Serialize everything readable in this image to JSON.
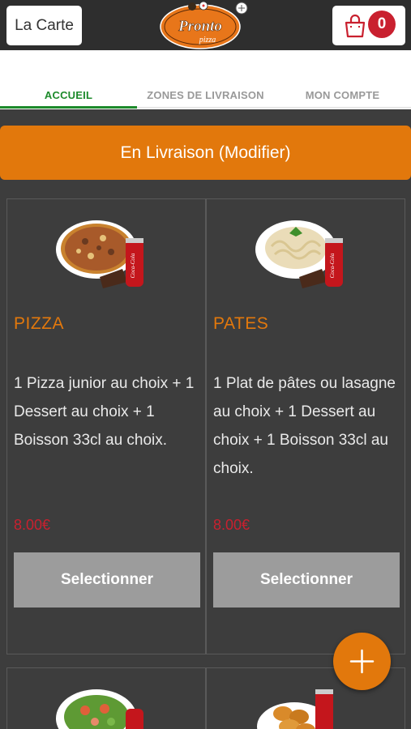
{
  "header": {
    "menu_button": "La Carte",
    "logo_text": "Pronto",
    "logo_subtext": "pizza",
    "cart_count": "0"
  },
  "tabs": [
    {
      "label": "ACCUEIL",
      "active": true
    },
    {
      "label": "ZONES DE LIVRAISON",
      "active": false
    },
    {
      "label": "MON COMPTE",
      "active": false
    }
  ],
  "delivery_button": "En Livraison (Modifier)",
  "products": [
    {
      "title": "PIZZA",
      "description": "1 Pizza junior au choix  + 1 Dessert au choix  + 1 Boisson 33cl au choix.",
      "price": "8.00€",
      "select_label": "Selectionner",
      "image": "pizza-coke-dessert"
    },
    {
      "title": "PATES",
      "description": "1 Plat de pâtes ou lasagne au choix  + 1 Dessert au choix  + 1 Boisson 33cl au choix.",
      "price": "8.00€",
      "select_label": "Selectionner",
      "image": "pasta-coke-dessert"
    },
    {
      "image": "salad-coke"
    },
    {
      "image": "nuggets-coke"
    }
  ],
  "colors": {
    "accent": "#e2780c",
    "active_tab": "#1d8a2b",
    "price": "#c9202f",
    "badge": "#c9202f",
    "background": "#3d3d3d"
  },
  "icons": [
    "cart-icon",
    "plus-icon"
  ]
}
